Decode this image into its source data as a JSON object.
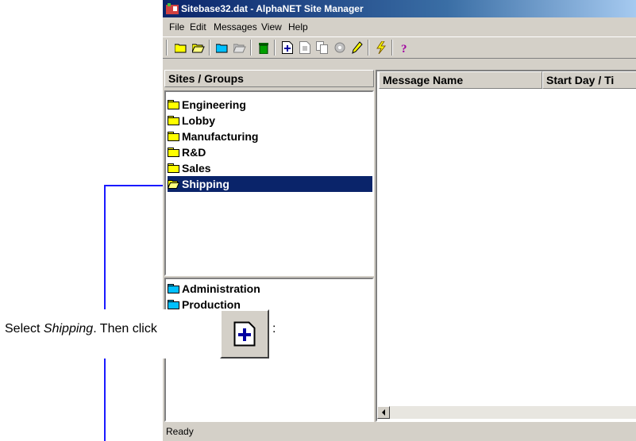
{
  "window": {
    "title": "Sitebase32.dat - AlphaNET Site Manager"
  },
  "menu": [
    "File",
    "Edit",
    "Messages",
    "View",
    "Help"
  ],
  "toolbar": {
    "icons": [
      "folder-icon",
      "folder-open-icon",
      "folder-blue-icon",
      "folder-open-icon",
      "trash-icon",
      "new-message-icon",
      "message-icon",
      "copy-icon",
      "settings-icon",
      "edit-pencil-icon",
      "lightning-icon",
      "help-question-icon"
    ]
  },
  "sites_pane": {
    "header": "Sites / Groups",
    "sites": [
      "Engineering",
      "Lobby",
      "Manufacturing",
      "R&D",
      "Sales",
      "Shipping"
    ],
    "selected": "Shipping",
    "groups": [
      "Administration",
      "Production"
    ]
  },
  "messages_pane": {
    "columns": [
      "Message Name",
      "Start Day / Ti"
    ]
  },
  "status": {
    "text": "Ready"
  },
  "annotation": {
    "prefix": "Select ",
    "emphasis": "Shipping",
    "suffix": ". Then click",
    "colon": ":"
  },
  "colors": {
    "selection": "#0a246a",
    "folder_yellow": "#ffff00",
    "folder_blue": "#00c0ff",
    "callout_line": "#1a1aff"
  }
}
